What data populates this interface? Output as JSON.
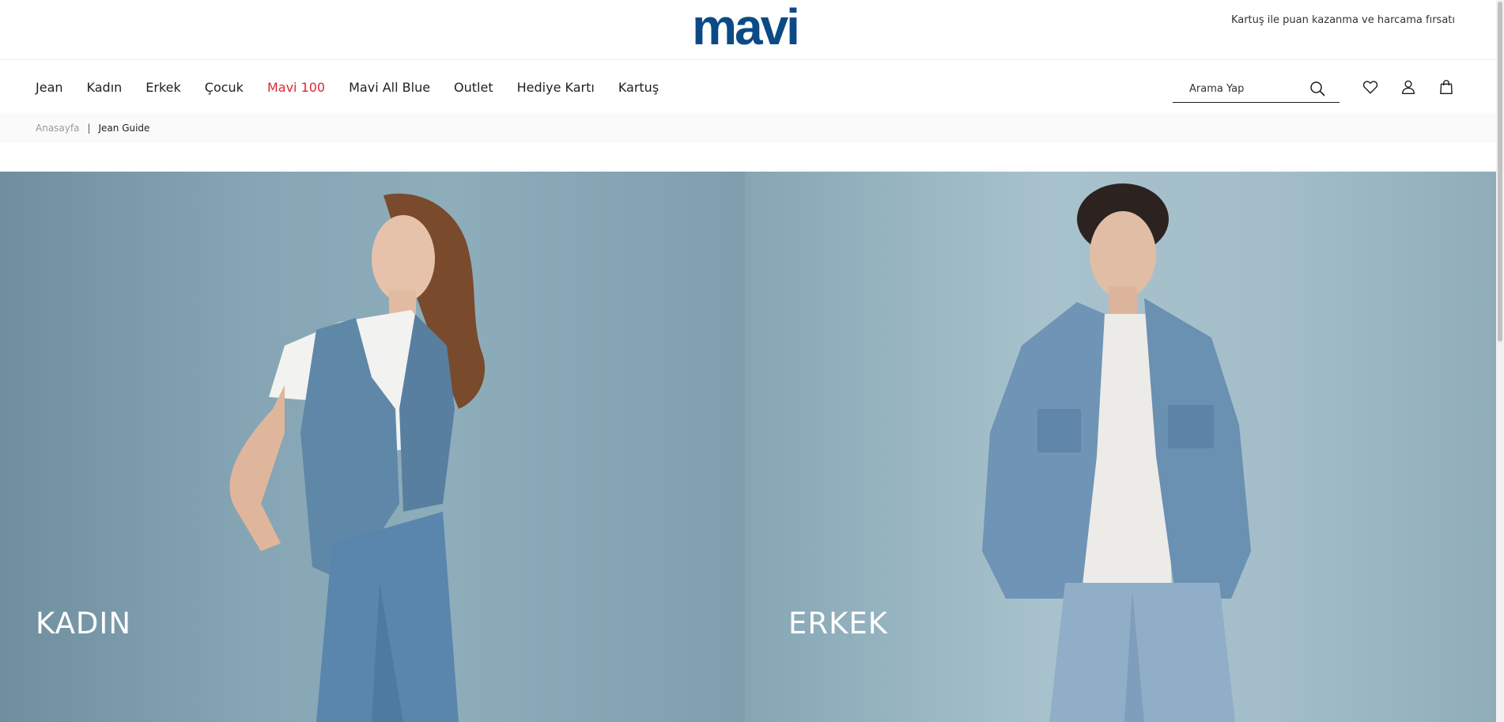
{
  "header": {
    "logo_text": "mavi",
    "promo_text": "Kartuş ile puan kazanma ve harcama fırsatı"
  },
  "nav": {
    "items": [
      {
        "label": "Jean",
        "highlight": false
      },
      {
        "label": "Kadın",
        "highlight": false
      },
      {
        "label": "Erkek",
        "highlight": false
      },
      {
        "label": "Çocuk",
        "highlight": false
      },
      {
        "label": "Mavi 100",
        "highlight": true
      },
      {
        "label": "Mavi All Blue",
        "highlight": false
      },
      {
        "label": "Outlet",
        "highlight": false
      },
      {
        "label": "Hediye Kartı",
        "highlight": false
      },
      {
        "label": "Kartuş",
        "highlight": false
      }
    ],
    "highlight_color": "#e0262f"
  },
  "search": {
    "placeholder": "Arama Yap",
    "icon": "search-icon"
  },
  "header_icons": [
    "heart-icon",
    "user-icon",
    "shopping-bag-icon"
  ],
  "breadcrumb": {
    "home": "Anasayfa",
    "separator": "|",
    "current": "Jean Guide"
  },
  "hero": {
    "left_title": "KADIN",
    "right_title": "ERKEK"
  },
  "colors": {
    "brand": "#0c4a86",
    "background": "#ffffff",
    "hero_left": "#86a6b5",
    "hero_right": "#a3bec9"
  }
}
